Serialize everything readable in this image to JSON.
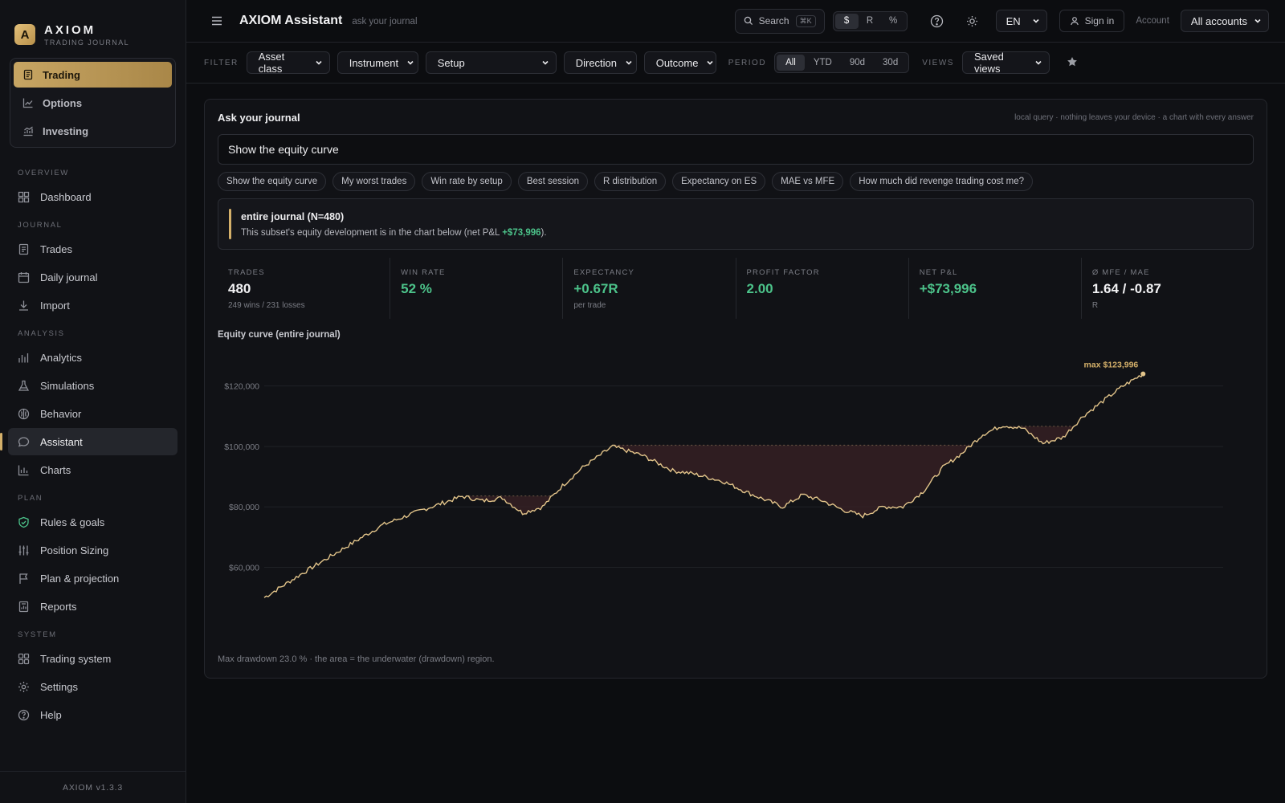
{
  "brand": {
    "logo_letter": "A",
    "title": "AXIOM",
    "subtitle": "TRADING JOURNAL"
  },
  "modes": [
    {
      "label": "Trading",
      "icon": "journal-icon",
      "active": true
    },
    {
      "label": "Options",
      "icon": "trend-chart-icon",
      "active": false
    },
    {
      "label": "Investing",
      "icon": "growth-chart-icon",
      "active": false
    }
  ],
  "nav": {
    "overview": {
      "title": "OVERVIEW",
      "items": [
        {
          "label": "Dashboard"
        }
      ]
    },
    "journal": {
      "title": "JOURNAL",
      "items": [
        {
          "label": "Trades"
        },
        {
          "label": "Daily journal"
        },
        {
          "label": "Import"
        }
      ]
    },
    "analysis": {
      "title": "ANALYSIS",
      "items": [
        {
          "label": "Analytics"
        },
        {
          "label": "Simulations"
        },
        {
          "label": "Behavior"
        },
        {
          "label": "Assistant"
        },
        {
          "label": "Charts"
        }
      ]
    },
    "plan": {
      "title": "PLAN",
      "items": [
        {
          "label": "Rules & goals"
        },
        {
          "label": "Position Sizing"
        },
        {
          "label": "Plan & projection"
        },
        {
          "label": "Reports"
        }
      ]
    },
    "system": {
      "title": "SYSTEM",
      "items": [
        {
          "label": "Trading system"
        },
        {
          "label": "Settings"
        },
        {
          "label": "Help"
        }
      ]
    }
  },
  "version": "AXIOM v1.3.3",
  "topbar": {
    "title": "AXIOM Assistant",
    "subtitle": "ask your journal",
    "search_label": "Search",
    "search_kbd": "⌘K",
    "units": [
      {
        "label": "$",
        "active": true
      },
      {
        "label": "R",
        "active": false
      },
      {
        "label": "%",
        "active": false
      }
    ],
    "language": "EN",
    "signin": "Sign in",
    "account_label": "Account",
    "accounts_select": "All accounts"
  },
  "filters": {
    "filter_label": "FILTER",
    "asset_class": "Asset class",
    "instrument": "Instrument",
    "setup": "Setup",
    "direction": "Direction",
    "outcome": "Outcome",
    "period_label": "PERIOD",
    "periods": [
      {
        "label": "All",
        "active": true
      },
      {
        "label": "YTD",
        "active": false
      },
      {
        "label": "90d",
        "active": false
      },
      {
        "label": "30d",
        "active": false
      }
    ],
    "views_label": "VIEWS",
    "saved_views": "Saved views"
  },
  "card": {
    "title": "Ask your journal",
    "note": "local query · nothing leaves your device · a chart with every answer",
    "query": "Show the equity curve",
    "chips": [
      "Show the equity curve",
      "My worst trades",
      "Win rate by setup",
      "Best session",
      "R distribution",
      "Expectancy on ES",
      "MAE vs MFE",
      "How much did revenge trading cost me?"
    ],
    "answer_title": "entire journal (N=480)",
    "answer_text_pre": "This subset's equity development is in the chart below (net P&L ",
    "answer_value": "+$73,996",
    "answer_text_post": ").",
    "stats": [
      {
        "label": "TRADES",
        "value": "480",
        "sub": "249 wins / 231 losses",
        "green": false
      },
      {
        "label": "WIN RATE",
        "value": "52 %",
        "sub": "",
        "green": true
      },
      {
        "label": "EXPECTANCY",
        "value": "+0.67R",
        "sub": "per trade",
        "green": true
      },
      {
        "label": "PROFIT FACTOR",
        "value": "2.00",
        "sub": "",
        "green": true
      },
      {
        "label": "NET P&L",
        "value": "+$73,996",
        "sub": "",
        "green": true
      },
      {
        "label": "Ø MFE / MAE",
        "value": "1.64 / -0.87",
        "sub": "R",
        "green": false
      }
    ],
    "chart_title": "Equity curve (entire journal)",
    "chart_foot": "Max drawdown 23.0 % · the area = the underwater (drawdown) region."
  },
  "chart_data": {
    "type": "line",
    "xlabel": "",
    "ylabel": "",
    "x_unit": "trade",
    "x": [
      1,
      20,
      40,
      60,
      80,
      100,
      110,
      120,
      130,
      140,
      150,
      160,
      175,
      190,
      205,
      215,
      230,
      245,
      260,
      270,
      280,
      290,
      300,
      310,
      320,
      330,
      340,
      350,
      360,
      370,
      380,
      390,
      400,
      410,
      420,
      430,
      440,
      450,
      460,
      470,
      480
    ],
    "values": [
      50000,
      58000,
      66000,
      74000,
      79000,
      83500,
      82000,
      83000,
      78000,
      80000,
      87000,
      93000,
      100000,
      97000,
      92000,
      91000,
      88500,
      84000,
      80000,
      84000,
      82000,
      79000,
      77000,
      80000,
      80000,
      85000,
      93000,
      98000,
      104000,
      107000,
      106000,
      101000,
      103000,
      110000,
      115000,
      120000,
      123996,
      123996,
      123996,
      123996,
      123996
    ],
    "ylim": [
      45000,
      130000
    ],
    "y_ticks": [
      "$60,000",
      "$80,000",
      "$100,000",
      "$120,000"
    ],
    "y_tick_values": [
      60000,
      80000,
      100000,
      120000
    ],
    "max_label": "max $123,996",
    "grid": true,
    "drawdown_shaded": true,
    "line_color": "#e2c48a",
    "drawdown_color": "#3a2226"
  }
}
